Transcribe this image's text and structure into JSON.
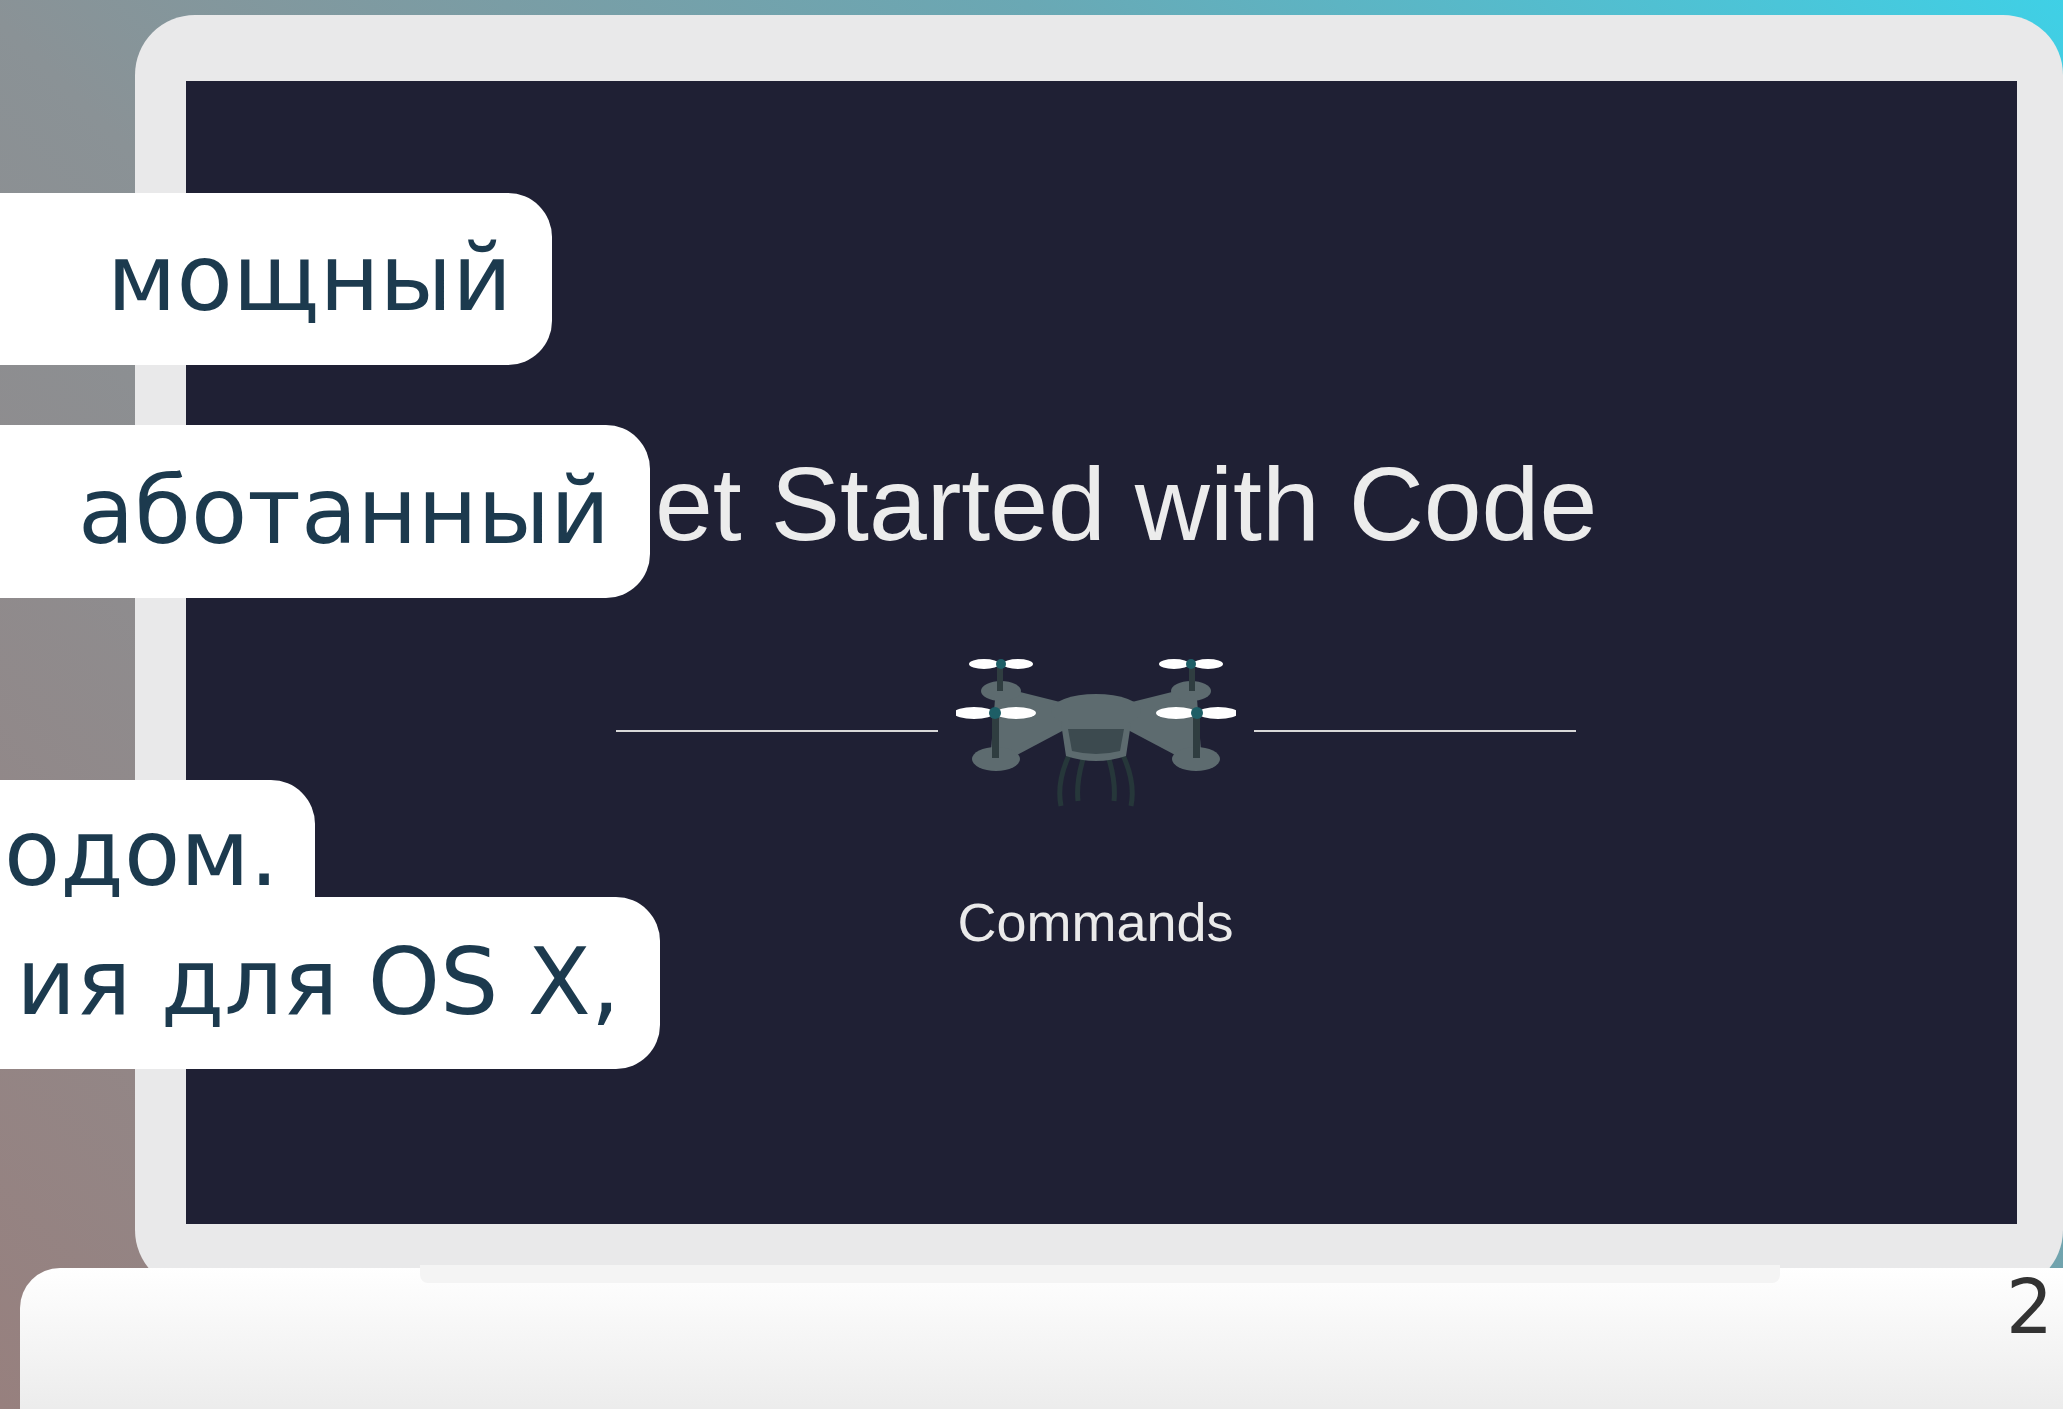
{
  "caption_bubbles": [
    {
      "text": "мощный"
    },
    {
      "text": "аботанный"
    },
    {
      "text": "одом."
    },
    {
      "text": "ия для OS X,"
    }
  ],
  "app_screen": {
    "title": "et Started with Code",
    "section_label": "Commands"
  },
  "page_number": "2"
}
